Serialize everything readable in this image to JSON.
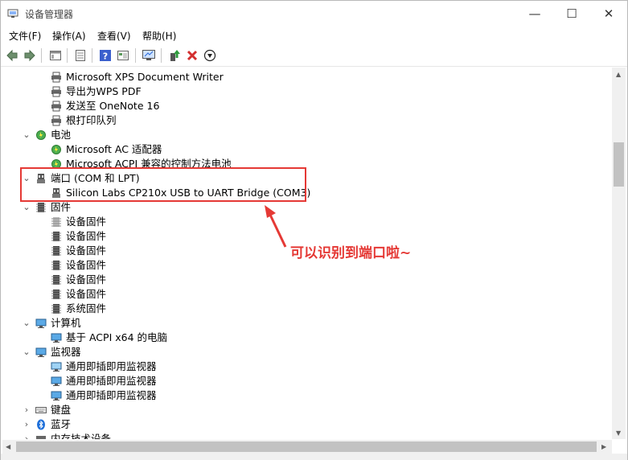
{
  "window": {
    "title": "设备管理器",
    "minimize_glyph": "—",
    "maximize_glyph": "☐",
    "close_glyph": "✕"
  },
  "menu": [
    {
      "label": "文件(F)"
    },
    {
      "label": "操作(A)"
    },
    {
      "label": "查看(V)"
    },
    {
      "label": "帮助(H)"
    }
  ],
  "toolbar": {
    "buttons": [
      {
        "icon": "back-arrow-icon"
      },
      {
        "icon": "forward-arrow-icon"
      },
      {
        "icon": "properties-window-icon"
      },
      {
        "icon": "device-list-icon"
      },
      {
        "icon": "help-icon"
      },
      {
        "icon": "device-view-icon"
      },
      {
        "icon": "scan-hardware-monitor-icon"
      },
      {
        "icon": "update-driver-icon"
      },
      {
        "icon": "uninstall-x-icon"
      },
      {
        "icon": "download-circle-icon"
      }
    ]
  },
  "tree": {
    "printers": [
      {
        "label": "Microsoft XPS Document Writer"
      },
      {
        "label": "导出为WPS PDF"
      },
      {
        "label": "发送至 OneNote 16"
      },
      {
        "label": "根打印队列"
      }
    ],
    "battery": {
      "label": "电池",
      "children": [
        {
          "label": "Microsoft AC 适配器"
        },
        {
          "label": "Microsoft ACPI 兼容的控制方法电池"
        }
      ]
    },
    "ports": {
      "label": "端口 (COM 和 LPT)",
      "children": [
        {
          "label": "Silicon Labs CP210x USB to UART Bridge (COM3)"
        }
      ]
    },
    "firmware": {
      "label": "固件",
      "children": [
        {
          "label": "设备固件"
        },
        {
          "label": "设备固件"
        },
        {
          "label": "设备固件"
        },
        {
          "label": "设备固件"
        },
        {
          "label": "设备固件"
        },
        {
          "label": "设备固件"
        },
        {
          "label": "系统固件"
        }
      ]
    },
    "computer": {
      "label": "计算机",
      "children": [
        {
          "label": "基于 ACPI x64 的电脑"
        }
      ]
    },
    "monitors": {
      "label": "监视器",
      "children": [
        {
          "label": "通用即插即用监视器"
        },
        {
          "label": "通用即插即用监视器"
        },
        {
          "label": "通用即插即用监视器"
        }
      ]
    },
    "keyboard": {
      "label": "键盘"
    },
    "bluetooth": {
      "label": "蓝牙"
    },
    "memory": {
      "label": "内存技术设备"
    }
  },
  "annotation": {
    "text": "可以识别到端口啦~",
    "color": "#e53935"
  }
}
